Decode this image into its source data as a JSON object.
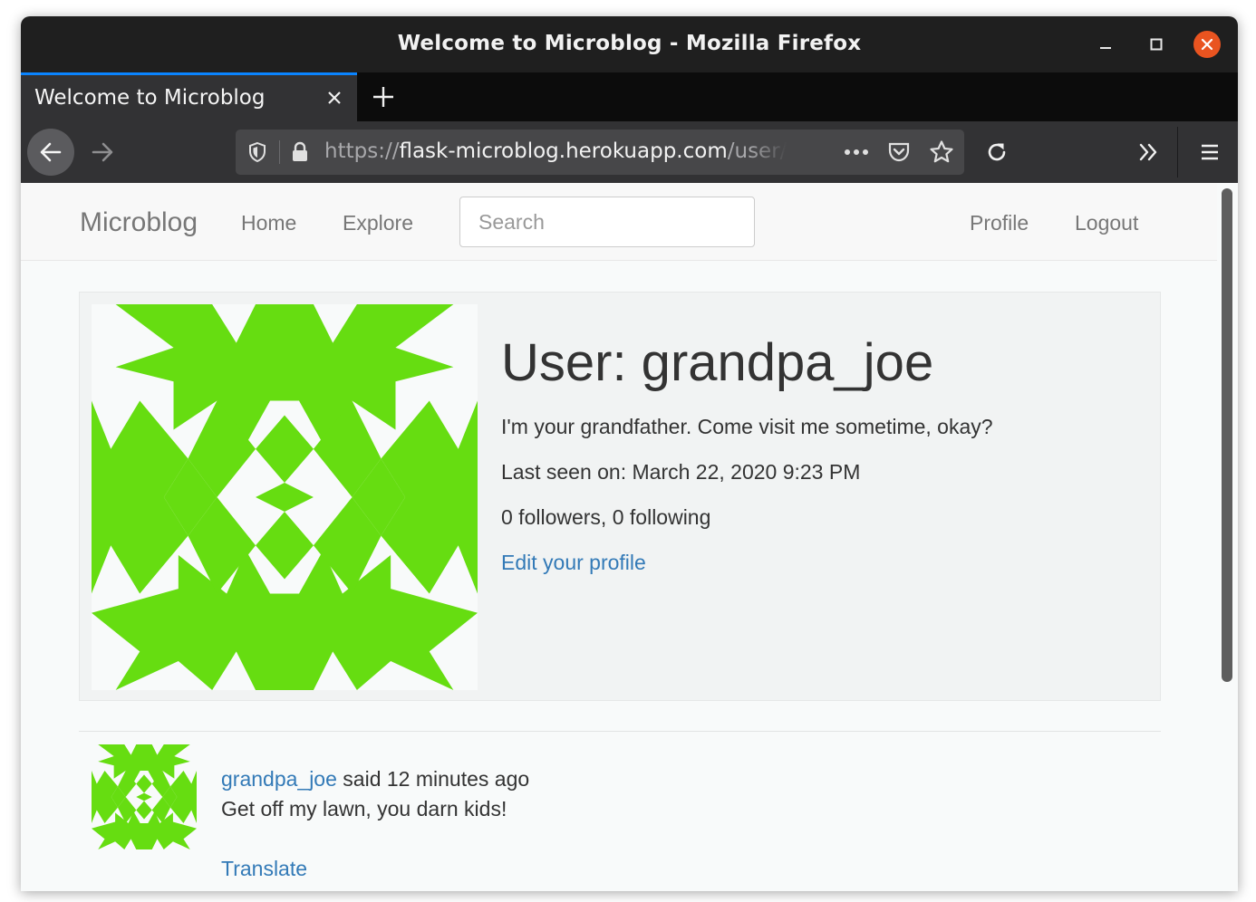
{
  "window": {
    "title": "Welcome to Microblog - Mozilla Firefox"
  },
  "tab": {
    "label": "Welcome to Microblog"
  },
  "urlbar": {
    "scheme": "https://",
    "host": "flask-microblog.herokuapp.com",
    "path": "/user/g"
  },
  "icons": {
    "back": "arrow-left-icon",
    "forward": "arrow-right-icon",
    "tracking": "shield-icon",
    "lock": "lock-icon",
    "page_actions": "ellipsis-icon",
    "pocket": "pocket-icon",
    "bookmark": "star-icon",
    "reload": "reload-icon",
    "overflow": "double-chevron-icon",
    "menu": "hamburger-icon"
  },
  "site_nav": {
    "brand": "Microblog",
    "home": "Home",
    "explore": "Explore",
    "search_placeholder": "Search",
    "profile": "Profile",
    "logout": "Logout"
  },
  "profile": {
    "heading": "User: grandpa_joe",
    "about": "I'm your grandfather. Come visit me sometime, okay?",
    "last_seen": "Last seen on: March 22, 2020 9:23 PM",
    "follow_counts": "0 followers, 0 following",
    "edit_link": "Edit your profile"
  },
  "post": {
    "author": "grandpa_joe",
    "said_time": " said 12 minutes ago",
    "body": "Get off my lawn, you darn kids!",
    "translate": "Translate"
  },
  "colors": {
    "identicon": "#66dd11",
    "link": "#337ab7",
    "tab_accent": "#0a84ff",
    "close_button": "#e95420"
  }
}
